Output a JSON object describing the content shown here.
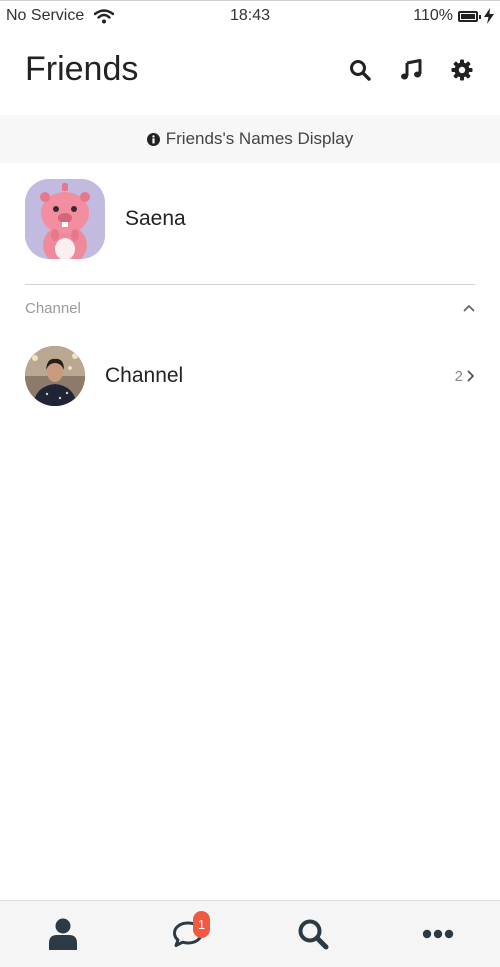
{
  "status_bar": {
    "carrier": "No Service",
    "time": "18:43",
    "battery": "110%"
  },
  "header": {
    "title": "Friends",
    "icons": [
      "search-icon",
      "music-note-icon",
      "gear-icon"
    ]
  },
  "names_display": {
    "label": "Friends's Names Display",
    "icon": "info-icon"
  },
  "profile": {
    "name": "Saena"
  },
  "channel_section": {
    "label": "Channel",
    "expanded": true,
    "items": [
      {
        "name": "Channel",
        "count": "2"
      }
    ]
  },
  "tab_bar": {
    "tabs": [
      {
        "icon": "person-icon",
        "active": true
      },
      {
        "icon": "chat-bubble-icon",
        "badge": "1"
      },
      {
        "icon": "search-icon"
      },
      {
        "icon": "more-icon"
      }
    ]
  },
  "colors": {
    "text": "#222222",
    "banner_bg": "#f7f7f7",
    "badge": "#f15a41",
    "avatar_bg": "#c3bae0"
  }
}
